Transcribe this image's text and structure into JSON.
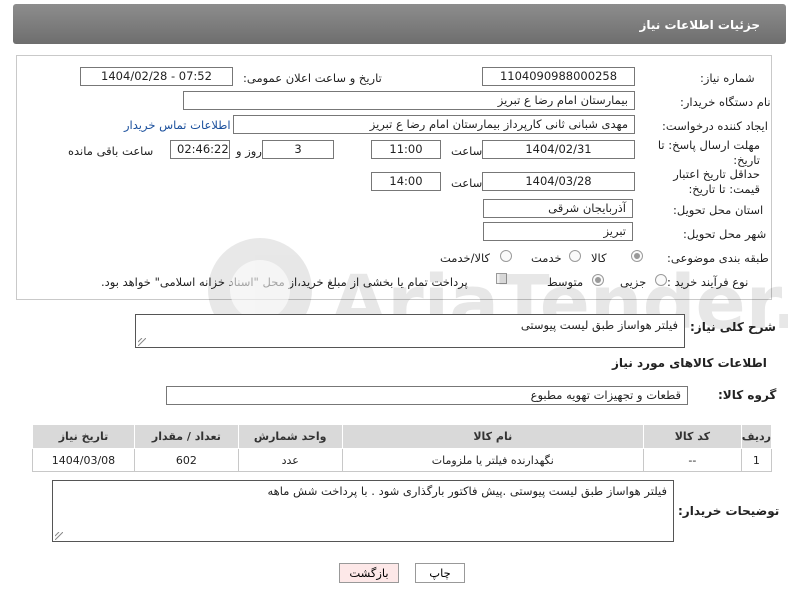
{
  "header": {
    "title": "جزئیات اطلاعات نیاز"
  },
  "form": {
    "need_number_label": "شماره نیاز:",
    "need_number": "1104090988000258",
    "announce_label": "تاریخ و ساعت اعلان عمومی:",
    "announce_value": "1404/02/28 - 07:52",
    "buyer_org_label": "نام دستگاه خریدار:",
    "buyer_org": "بیمارستان امام رضا  ع  تبریز",
    "requester_label": "ایجاد کننده درخواست:",
    "requester": "مهدی شبانی ثانی کارپرداز بیمارستان امام رضا  ع  تبریز",
    "contact_link": "اطلاعات تماس خریدار",
    "reply_deadline_label": "مهلت ارسال پاسخ: تا تاریخ:",
    "reply_date": "1404/02/31",
    "time_label": "ساعت",
    "reply_time": "11:00",
    "days": "3",
    "days_label": "روز و",
    "remaining_time": "02:46:22",
    "remaining_label": "ساعت باقی مانده",
    "price_validity_label": "حداقل تاریخ اعتبار قیمت: تا تاریخ:",
    "price_date": "1404/03/28",
    "price_time": "14:00",
    "province_label": "استان محل تحویل:",
    "province": "آذربایجان شرقی",
    "city_label": "شهر محل تحویل:",
    "city": "تبریز",
    "category_label": "طبقه بندی موضوعی:",
    "category_options": [
      "کالا",
      "خدمت",
      "کالا/خدمت"
    ],
    "process_label": "نوع فرآیند خرید :",
    "process_options": [
      "جزیی",
      "متوسط"
    ],
    "payment_note": "پرداخت تمام یا بخشی از مبلغ خرید،از محل \"اسناد خزانه اسلامی\" خواهد بود."
  },
  "summary": {
    "label": "شرح کلی نیاز:",
    "text": "فیلتر هواساز طبق لیست پیوستی"
  },
  "goods_section": {
    "title": "اطلاعات کالاهای مورد نیاز",
    "group_label": "گروه کالا:",
    "group_value": "قطعات و تجهیزات تهویه مطبوع"
  },
  "table": {
    "headers": [
      "ردیف",
      "کد کالا",
      "نام کالا",
      "واحد شمارش",
      "تعداد / مقدار",
      "تاریخ نیاز"
    ],
    "rows": [
      [
        "1",
        "--",
        "نگهدارنده فیلتر یا ملزومات",
        "عدد",
        "602",
        "1404/03/08"
      ]
    ]
  },
  "buyer_notes": {
    "label": "توضیحات خریدار:",
    "text": "فیلتر هواساز طبق لیست پیوستی .پیش فاکتور بارگذاری شود . با پرداخت شش ماهه"
  },
  "buttons": {
    "print": "چاپ",
    "back": "بازگشت"
  },
  "colors": {
    "header_bg": "#7d7d7d",
    "link": "#1a4f9c",
    "back_button_bg": "#fde8e8"
  }
}
